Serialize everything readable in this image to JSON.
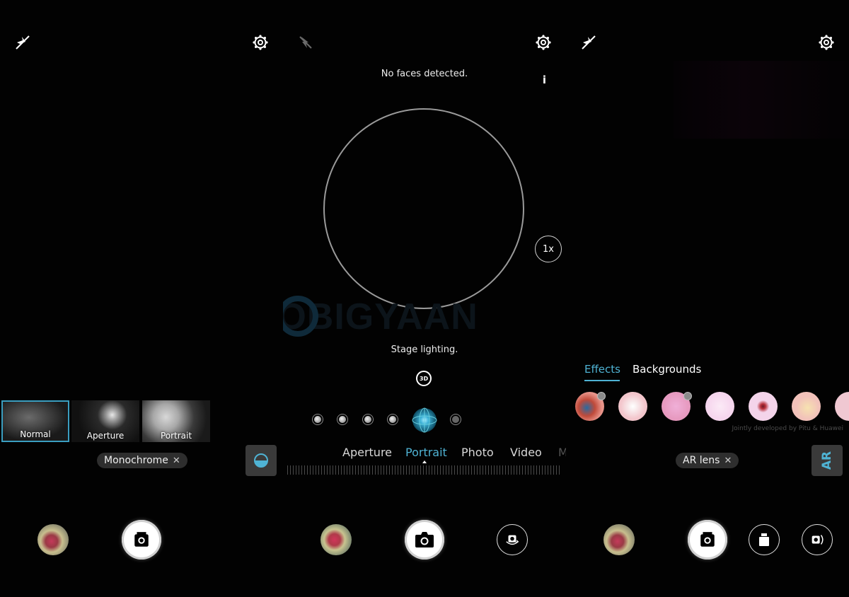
{
  "colors": {
    "accent": "#4fb3d4",
    "background": "#000000",
    "chip_bg": "#2e2e2e"
  },
  "panels": [
    {
      "id": "monochrome",
      "top_bar": {
        "flash_icon": "flash-off-icon",
        "settings_icon": "gear-icon"
      },
      "filters": [
        {
          "label": "Normal",
          "selected": true
        },
        {
          "label": "Aperture",
          "selected": false
        },
        {
          "label": "Portrait",
          "selected": false
        }
      ],
      "mode_chip": {
        "label": "Monochrome",
        "close": "✕"
      },
      "bottom": {
        "gallery": "gallery-thumbnail",
        "shutter": "shutter-button"
      }
    },
    {
      "id": "portrait",
      "top_bar": {
        "flash_icon": "flash-off-icon",
        "settings_icon": "gear-icon"
      },
      "status": "No faces detected.",
      "info_label": "i",
      "zoom_label": "1x",
      "watermark": "MOBIGYAAN",
      "lighting_label": "Stage lighting.",
      "badge_3d": "3D",
      "lighting_options": [
        "natural",
        "soft",
        "butterfly",
        "split",
        "stage",
        "classic"
      ],
      "lighting_selected": 4,
      "modes": [
        {
          "label": "Aperture",
          "active": false
        },
        {
          "label": "Portrait",
          "active": true
        },
        {
          "label": "Photo",
          "active": false
        },
        {
          "label": "Video",
          "active": false
        },
        {
          "label": "M",
          "active": false
        }
      ],
      "bottom": {
        "gallery": "gallery-thumbnail",
        "shutter": "shutter-button",
        "switch": "switch-camera-button"
      }
    },
    {
      "id": "ar-lens",
      "top_bar": {
        "flash_icon": "flash-off-icon",
        "settings_icon": "gear-icon"
      },
      "tabs": [
        {
          "label": "Effects",
          "active": true
        },
        {
          "label": "Backgrounds",
          "active": false
        }
      ],
      "effects": [
        {
          "name": "effect-1",
          "color": "#e8948a",
          "badge": true
        },
        {
          "name": "effect-2",
          "color": "#f3c6cc",
          "badge": false
        },
        {
          "name": "effect-3",
          "color": "#e79ac0",
          "badge": true
        },
        {
          "name": "effect-4",
          "color": "#f6d6ee",
          "badge": false
        },
        {
          "name": "effect-5",
          "color": "#f4d4ea",
          "badge": false
        },
        {
          "name": "effect-6",
          "color": "#f2c2ba",
          "badge": false
        },
        {
          "name": "effect-7",
          "color": "#f0c8d2",
          "badge": false
        }
      ],
      "credit": "Jointly developed by Pitu & Huawei",
      "mode_chip": {
        "label": "AR lens",
        "close": "✕"
      },
      "ar_button": "AR",
      "bottom": {
        "gallery": "gallery-thumbnail",
        "shutter": "shutter-button",
        "jar": "jar-button",
        "switch": "switch-camera-button"
      }
    }
  ]
}
